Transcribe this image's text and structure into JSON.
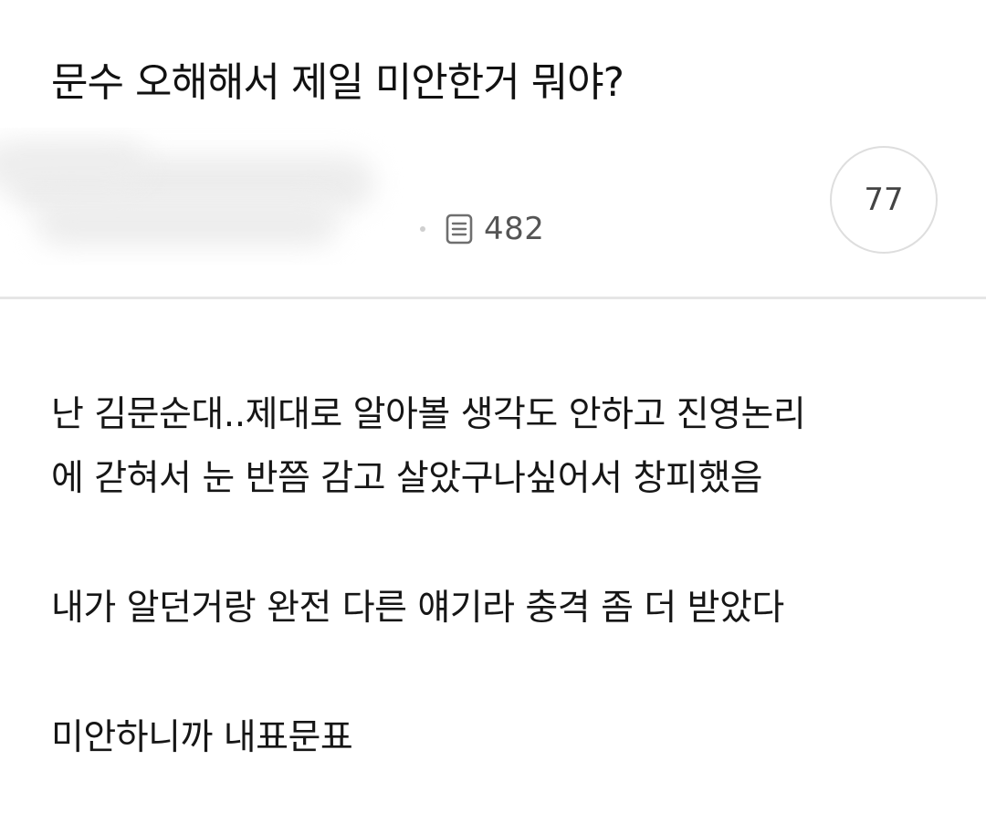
{
  "post": {
    "title": "문수 오해해서 제일 미안한거 뭐야?",
    "meta": {
      "views_icon": "document-icon",
      "views": "482"
    },
    "comment_count": "77"
  },
  "body": {
    "paragraphs": [
      {
        "lines": [
          "난 김문순대..제대로 알아볼 생각도 안하고 진영논리",
          "에 갇혀서 눈 반쯤 감고 살았구나싶어서 창피했음"
        ]
      },
      {
        "lines": [
          "내가 알던거랑 완전 다른 얘기라 충격 좀 더 받았다"
        ]
      },
      {
        "lines": [
          "미안하니까 내표문표"
        ]
      }
    ]
  },
  "colors": {
    "text": "#161616",
    "meta_text": "#555555",
    "divider": "#e6e6e6",
    "circle_border": "#dedede"
  }
}
